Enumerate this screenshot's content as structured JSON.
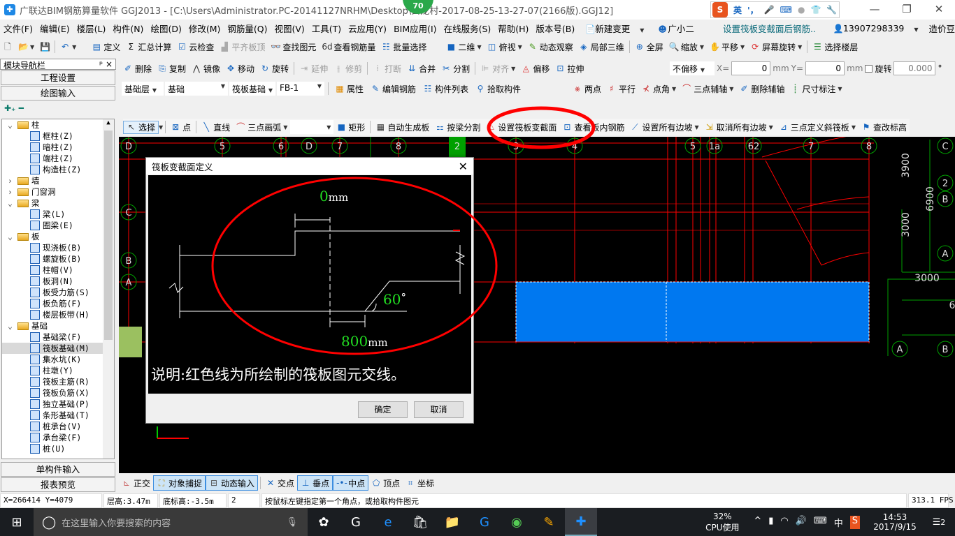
{
  "title": {
    "text": "广联达BIM钢筋算量软件 GGJ2013 - [C:\\Users\\Administrator.PC-20141127NRHM\\Desktop\\白龙村-2017-08-25-13-27-07(2166版).GGJ12]",
    "badge": "70"
  },
  "ime": {
    "logo": "S",
    "mode": "英",
    "punct": "'，"
  },
  "menu": [
    "文件(F)",
    "编辑(E)",
    "楼层(L)",
    "构件(N)",
    "绘图(D)",
    "修改(M)",
    "钢筋量(Q)",
    "视图(V)",
    "工具(T)",
    "云应用(Y)",
    "BIM应用(I)",
    "在线服务(S)",
    "帮助(H)",
    "版本号(B)",
    "新建变更",
    "广小二"
  ],
  "menu_notice": "设置筏板变截面后钢筋..",
  "account": {
    "phone": "13907298339",
    "beans": "造价豆:0"
  },
  "toolbar1": [
    "定义",
    "汇总计算",
    "云检查",
    "平齐板顶",
    "查找图元",
    "查看钢筋量",
    "批量选择"
  ],
  "toolbar1b": [
    "二维",
    "俯视",
    "动态观察",
    "局部三维",
    "全屏",
    "缩放",
    "平移",
    "屏幕旋转",
    "选择楼层"
  ],
  "toolbar2": [
    "删除",
    "复制",
    "镜像",
    "移动",
    "旋转",
    "延伸",
    "修剪",
    "打断",
    "合并",
    "分割",
    "对齐",
    "偏移",
    "拉伸"
  ],
  "toolbar2_right": {
    "offset": "不偏移",
    "x_label": "X=",
    "x": "0",
    "y_label": "Y=",
    "y": "0",
    "unit": "mm",
    "rotate_label": "旋转",
    "rotate": "0.000",
    "deg": "°"
  },
  "toolbar3": {
    "floor": "基础层",
    "type": "基础",
    "component": "筏板基础",
    "name": "FB-1",
    "actions": [
      "属性",
      "编辑钢筋",
      "构件列表",
      "拾取构件"
    ],
    "aux": [
      "两点",
      "平行",
      "点角",
      "三点辅轴",
      "删除辅轴",
      "尺寸标注"
    ]
  },
  "toolbar4": [
    "选择",
    "点",
    "直线",
    "三点画弧",
    "矩形",
    "自动生成板",
    "按梁分割",
    "设置筏板变截面",
    "查看板内钢筋",
    "设置所有边坡",
    "取消所有边坡",
    "三点定义斜筏板",
    "查改标高"
  ],
  "nav": {
    "title": "模块导航栏",
    "pin": "ᵖ",
    "close": "×",
    "project": "工程设置",
    "draw": "绘图输入",
    "single": "单构件输入",
    "report": "报表预览",
    "tree": [
      {
        "label": "柱",
        "level": 0,
        "folder": true,
        "open": true
      },
      {
        "label": "框柱(Z)",
        "level": 1
      },
      {
        "label": "暗柱(Z)",
        "level": 1
      },
      {
        "label": "端柱(Z)",
        "level": 1
      },
      {
        "label": "构造柱(Z)",
        "level": 1
      },
      {
        "label": "墙",
        "level": 0,
        "folder": true,
        "open": false
      },
      {
        "label": "门窗洞",
        "level": 0,
        "folder": true,
        "open": false
      },
      {
        "label": "梁",
        "level": 0,
        "folder": true,
        "open": true
      },
      {
        "label": "梁(L)",
        "level": 1
      },
      {
        "label": "圈梁(E)",
        "level": 1
      },
      {
        "label": "板",
        "level": 0,
        "folder": true,
        "open": true
      },
      {
        "label": "现浇板(B)",
        "level": 1
      },
      {
        "label": "螺旋板(B)",
        "level": 1
      },
      {
        "label": "柱帽(V)",
        "level": 1
      },
      {
        "label": "板洞(N)",
        "level": 1
      },
      {
        "label": "板受力筋(S)",
        "level": 1
      },
      {
        "label": "板负筋(F)",
        "level": 1
      },
      {
        "label": "楼层板带(H)",
        "level": 1
      },
      {
        "label": "基础",
        "level": 0,
        "folder": true,
        "open": true
      },
      {
        "label": "基础梁(F)",
        "level": 1
      },
      {
        "label": "筏板基础(M)",
        "level": 1,
        "selected": true
      },
      {
        "label": "集水坑(K)",
        "level": 1
      },
      {
        "label": "柱墩(Y)",
        "level": 1
      },
      {
        "label": "筏板主筋(R)",
        "level": 1
      },
      {
        "label": "筏板负筋(X)",
        "level": 1
      },
      {
        "label": "独立基础(P)",
        "level": 1
      },
      {
        "label": "条形基础(T)",
        "level": 1
      },
      {
        "label": "桩承台(V)",
        "level": 1
      },
      {
        "label": "承台梁(F)",
        "level": 1
      },
      {
        "label": "桩(U)",
        "level": 1
      }
    ]
  },
  "canvas": {
    "top_axes": [
      "D",
      "5",
      "6",
      "D",
      "7",
      "8",
      "2",
      "3",
      "4",
      "5",
      "1a",
      "62",
      "7",
      "8",
      "C"
    ],
    "left_axes": [
      "C",
      "B",
      "A"
    ],
    "right_axes": [
      "2",
      "B",
      "A",
      "A",
      "B"
    ],
    "dims": [
      "3900",
      "6900",
      "3000",
      "3000",
      "6"
    ],
    "colors": {
      "slab": "#0078f0",
      "grid": "#ff0000",
      "axis": "#00a000",
      "highlight": "#ff0000"
    }
  },
  "dialog": {
    "title": "筏板变截面定义",
    "top_offset": "0",
    "top_unit": "mm",
    "angle": "60",
    "angle_unit": "°",
    "width": "800",
    "width_unit": "mm",
    "note": "说明:红色线为所绘制的筏板图元交线。",
    "ok": "确定",
    "cancel": "取消"
  },
  "snap": [
    "正交",
    "对象捕捉",
    "动态输入",
    "交点",
    "垂点",
    "中点",
    "顶点",
    "坐标"
  ],
  "status": {
    "coords": "X=266414 Y=4079",
    "floor_height": "层高:3.47m",
    "bottom_elev": "底标高:-3.5m",
    "num": "2",
    "hint": "按鼠标左键指定第一个角点，或拾取构件图元",
    "fps": "313.1 FPS"
  },
  "taskbar": {
    "search": "在这里输入你要搜索的内容",
    "cpu": "32%",
    "cpu_label": "CPU使用",
    "lang": "中",
    "time": "14:53",
    "date": "2017/9/15",
    "notif": "2"
  }
}
